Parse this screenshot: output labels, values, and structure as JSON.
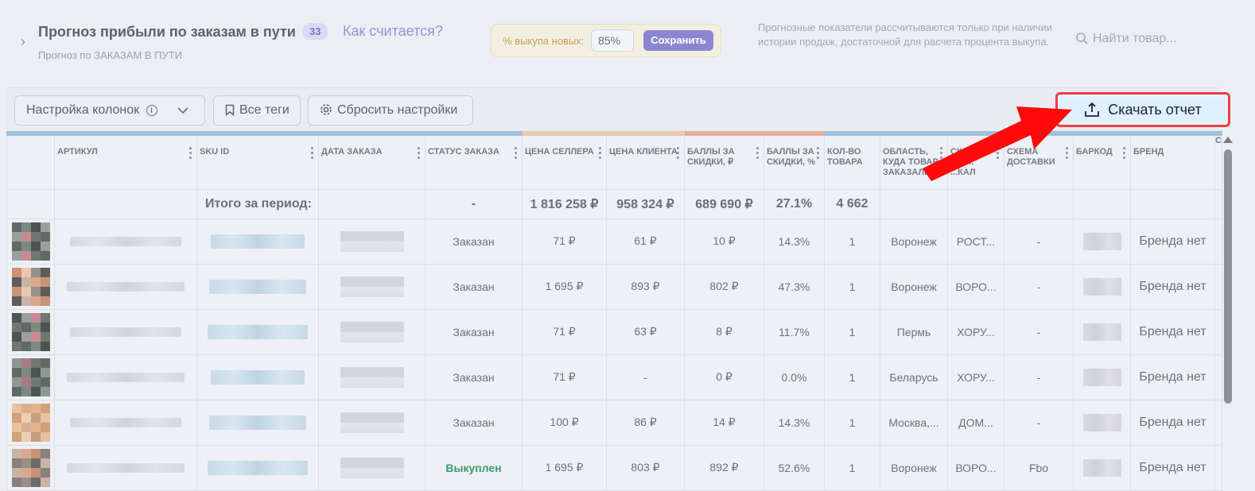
{
  "header": {
    "title": "Прогноз прибыли по заказам в пути",
    "badge": "33",
    "how_link": "Как считается?",
    "subtitle": "Прогноз по ЗАКАЗАМ В ПУТИ",
    "buyout_label": "% выкупа новых:",
    "buyout_value": "85%",
    "save_label": "Сохранить",
    "note": "Прогнозные показатели рассчитываются только при наличии истории продаж, достаточной для расчета процента выкупа.",
    "search_placeholder": "Найти товар..."
  },
  "toolbar": {
    "columns_label": "Настройка колонок",
    "tags_label": "Все теги",
    "reset_label": "Сбросить настройки",
    "download_label": "Скачать отчет"
  },
  "table": {
    "headers": [
      "",
      "АРТИКУЛ",
      "SKU ID",
      "ДАТА ЗАКАЗА",
      "СТАТУС ЗАКАЗА",
      "ЦЕНА СЕЛЛЕРА",
      "ЦЕНА КЛИЕНТА",
      "БАЛЛЫ ЗА СКИДКИ, ₽",
      "БАЛЛЫ ЗА СКИДКИ, %",
      "КОЛ-ВО ТОВАРА",
      "ОБЛАСТЬ, КУДА ТОВАР ЗАКАЗАЛИ",
      "СКЛАД ОТГ... ...КАЛ",
      "СХЕМА ДОСТАВКИ",
      "БАРКОД",
      "БРЕНД",
      "С"
    ],
    "total": {
      "label": "Итого за период:",
      "status": "-",
      "seller_price": "1 816 258 ₽",
      "client_price": "958 324 ₽",
      "points_rub": "689 690 ₽",
      "points_pct": "27.1%",
      "qty": "4 662"
    },
    "rows": [
      {
        "status": "Заказан",
        "seller": "71 ₽",
        "client": "61 ₽",
        "points": "10 ₽",
        "pct": "14.3%",
        "qty": "1",
        "region": "Воронеж",
        "warehouse": "РОСТ...",
        "scheme": "-",
        "brand": "Бренда нет"
      },
      {
        "status": "Заказан",
        "seller": "1 695 ₽",
        "client": "893 ₽",
        "points": "802 ₽",
        "pct": "47.3%",
        "qty": "1",
        "region": "Воронеж",
        "warehouse": "ВОРО...",
        "scheme": "-",
        "brand": "Бренда нет"
      },
      {
        "status": "Заказан",
        "seller": "71 ₽",
        "client": "63 ₽",
        "points": "8 ₽",
        "pct": "11.7%",
        "qty": "1",
        "region": "Пермь",
        "warehouse": "ХОРУ...",
        "scheme": "-",
        "brand": "Бренда нет"
      },
      {
        "status": "Заказан",
        "seller": "71 ₽",
        "client": "-",
        "points": "0 ₽",
        "pct": "0.0%",
        "qty": "1",
        "region": "Беларусь",
        "warehouse": "ХОРУ...",
        "scheme": "-",
        "brand": "Бренда нет"
      },
      {
        "status": "Заказан",
        "seller": "100 ₽",
        "client": "86 ₽",
        "points": "14 ₽",
        "pct": "14.3%",
        "qty": "1",
        "region": "Москва,...",
        "warehouse": "ДОМ...",
        "scheme": "-",
        "brand": "Бренда нет"
      },
      {
        "status": "Выкуплен",
        "seller": "1 695 ₽",
        "client": "803 ₽",
        "points": "892 ₽",
        "pct": "52.6%",
        "qty": "1",
        "region": "Воронеж",
        "warehouse": "ВОРО...",
        "scheme": "Fbo",
        "brand": "Бренда нет"
      }
    ]
  },
  "colors": {
    "accent_purple": "#8c86d2",
    "highlight_red": "#ef3e44",
    "status_green": "#3e9a6c"
  }
}
